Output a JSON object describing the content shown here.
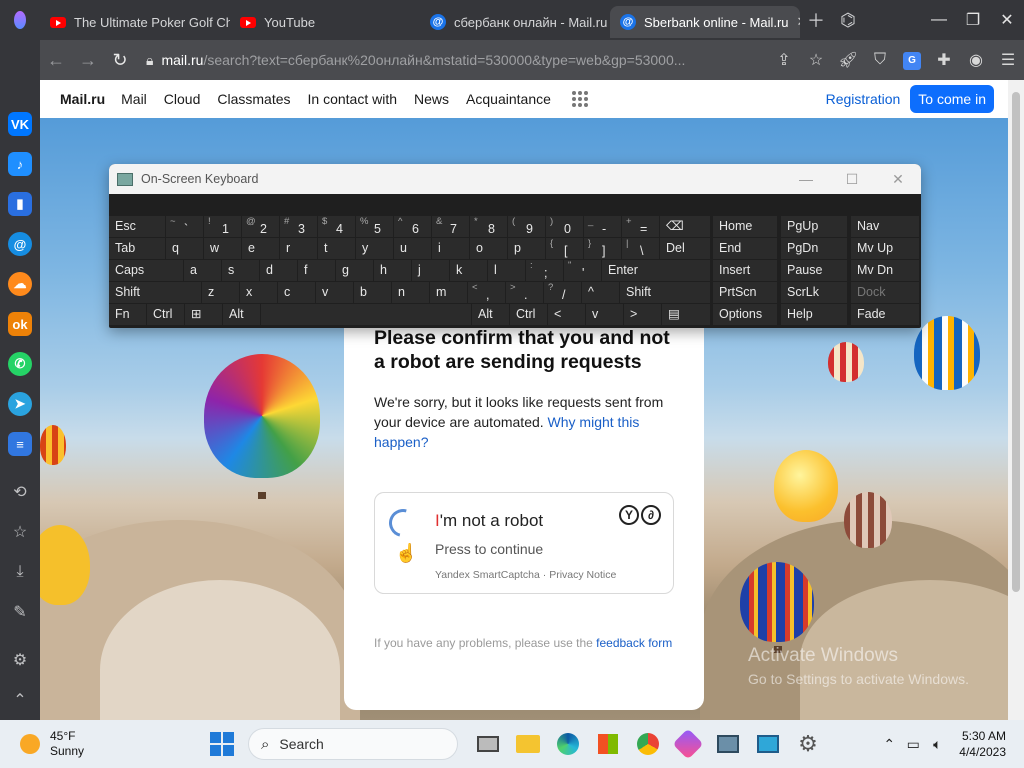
{
  "browser": {
    "tabs": [
      {
        "label": "The Ultimate Poker Golf Ch",
        "icon": "youtube-icon"
      },
      {
        "label": "YouTube",
        "icon": "youtube-icon"
      },
      {
        "label": "сбербанк онлайн - Mail.ru",
        "icon": "mail-icon"
      },
      {
        "label": "Sberbank online - Mail.ru",
        "icon": "mail-icon"
      }
    ],
    "url_host": "mail.ru",
    "url_rest": "/search?text=сбербанк%20онлайн&mstatid=530000&type=web&gp=53000..."
  },
  "mail_nav": {
    "logo": "Mail.ru",
    "links": [
      "Mail",
      "Cloud",
      "Classmates",
      "In contact with",
      "News",
      "Acquaintance"
    ],
    "registration": "Registration",
    "login": "To come in"
  },
  "captcha_page": {
    "heading": "Please confirm that you and not a robot are sending requests",
    "desc_text": "We're sorry, but it looks like requests sent from your device are automated.",
    "desc_link": "Why might this happen?",
    "captcha_title_i": "I",
    "captcha_title_rest": "'m not a robot",
    "captcha_sub": "Press to continue",
    "captcha_footer": "Yandex SmartCaptcha · Privacy Notice",
    "help_text": "If you have any problems, please use the",
    "help_link": "feedback form"
  },
  "watermark": {
    "line1": "Activate Windows",
    "line2": "Go to Settings to activate Windows."
  },
  "osk": {
    "title": "On-Screen Keyboard",
    "row1": [
      {
        "m": "Esc"
      },
      {
        "s": "~",
        "m": "`"
      },
      {
        "s": "!",
        "m": "1"
      },
      {
        "s": "@",
        "m": "2"
      },
      {
        "s": "#",
        "m": "3"
      },
      {
        "s": "$",
        "m": "4"
      },
      {
        "s": "%",
        "m": "5"
      },
      {
        "s": "^",
        "m": "6"
      },
      {
        "s": "&",
        "m": "7"
      },
      {
        "s": "*",
        "m": "8"
      },
      {
        "s": "(",
        "m": "9"
      },
      {
        "s": ")",
        "m": "0"
      },
      {
        "s": "_",
        "m": "-"
      },
      {
        "s": "+",
        "m": "="
      },
      {
        "m": "⌫"
      }
    ],
    "row2": [
      {
        "m": "Tab"
      },
      {
        "m": "q"
      },
      {
        "m": "w"
      },
      {
        "m": "e"
      },
      {
        "m": "r"
      },
      {
        "m": "t"
      },
      {
        "m": "y"
      },
      {
        "m": "u"
      },
      {
        "m": "i"
      },
      {
        "m": "o"
      },
      {
        "m": "p"
      },
      {
        "s": "{",
        "m": "["
      },
      {
        "s": "}",
        "m": "]"
      },
      {
        "s": "|",
        "m": "\\"
      },
      {
        "m": "Del"
      }
    ],
    "row3": [
      {
        "m": "Caps"
      },
      {
        "m": "a"
      },
      {
        "m": "s"
      },
      {
        "m": "d"
      },
      {
        "m": "f"
      },
      {
        "m": "g"
      },
      {
        "m": "h"
      },
      {
        "m": "j"
      },
      {
        "m": "k"
      },
      {
        "m": "l"
      },
      {
        "s": ":",
        "m": ";"
      },
      {
        "s": "\"",
        "m": "'"
      },
      {
        "m": "Enter"
      }
    ],
    "row4": [
      {
        "m": "Shift"
      },
      {
        "m": "z"
      },
      {
        "m": "x"
      },
      {
        "m": "c"
      },
      {
        "m": "v"
      },
      {
        "m": "b"
      },
      {
        "m": "n"
      },
      {
        "m": "m"
      },
      {
        "s": "<",
        "m": ","
      },
      {
        "s": ">",
        "m": "."
      },
      {
        "s": "?",
        "m": "/"
      },
      {
        "m": "^"
      },
      {
        "m": "Shift"
      }
    ],
    "row5": [
      {
        "m": "Fn"
      },
      {
        "m": "Ctrl"
      },
      {
        "m": "⊞"
      },
      {
        "m": "Alt"
      },
      {
        "m": ""
      },
      {
        "m": "Alt"
      },
      {
        "m": "Ctrl"
      },
      {
        "m": "<"
      },
      {
        "m": "v"
      },
      {
        "m": ">"
      },
      {
        "m": "▤"
      }
    ],
    "nav_col1": [
      "Home",
      "End",
      "Insert",
      "PrtScn",
      "Options"
    ],
    "nav_col2": [
      "PgUp",
      "PgDn",
      "Pause",
      "ScrLk",
      "Help"
    ],
    "nav_col3": [
      "Nav",
      "Mv Up",
      "Mv Dn",
      "Dock",
      "Fade"
    ]
  },
  "taskbar": {
    "temperature": "45°F",
    "weather": "Sunny",
    "search": "Search",
    "time": "5:30 AM",
    "date": "4/4/2023"
  }
}
